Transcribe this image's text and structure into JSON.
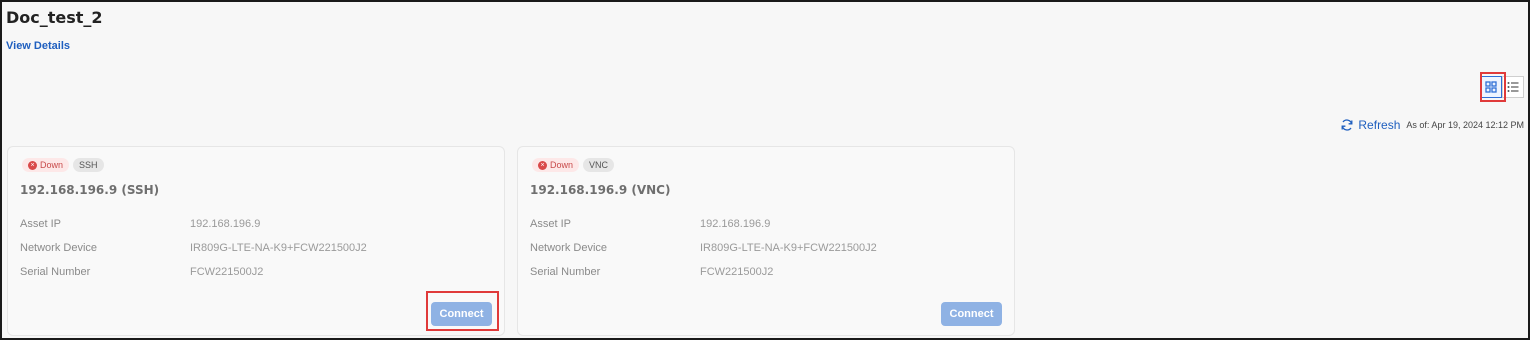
{
  "page": {
    "title": "Doc_test_2",
    "view_details": "View Details"
  },
  "toolbar": {
    "view_modes": [
      "grid",
      "list"
    ],
    "active_view": "grid",
    "refresh_label": "Refresh",
    "as_of": "As of: Apr 19, 2024 12:12 PM"
  },
  "cards": [
    {
      "status": "Down",
      "protocol": "SSH",
      "title": "192.168.196.9 (SSH)",
      "fields": [
        {
          "label": "Asset IP",
          "value": "192.168.196.9"
        },
        {
          "label": "Network Device",
          "value": "IR809G-LTE-NA-K9+FCW221500J2"
        },
        {
          "label": "Serial Number",
          "value": "FCW221500J2"
        }
      ],
      "action": "Connect"
    },
    {
      "status": "Down",
      "protocol": "VNC",
      "title": "192.168.196.9 (VNC)",
      "fields": [
        {
          "label": "Asset IP",
          "value": "192.168.196.9"
        },
        {
          "label": "Network Device",
          "value": "IR809G-LTE-NA-K9+FCW221500J2"
        },
        {
          "label": "Serial Number",
          "value": "FCW221500J2"
        }
      ],
      "action": "Connect"
    }
  ],
  "colors": {
    "accent": "#1f5fbf",
    "status_down": "#d94a4a",
    "connect_button": "#8fb2e4",
    "highlight": "#e03a3a"
  },
  "icons": {
    "grid_view": "grid-icon",
    "list_view": "list-icon",
    "refresh": "refresh-icon",
    "status_down": "error-circle-icon"
  }
}
